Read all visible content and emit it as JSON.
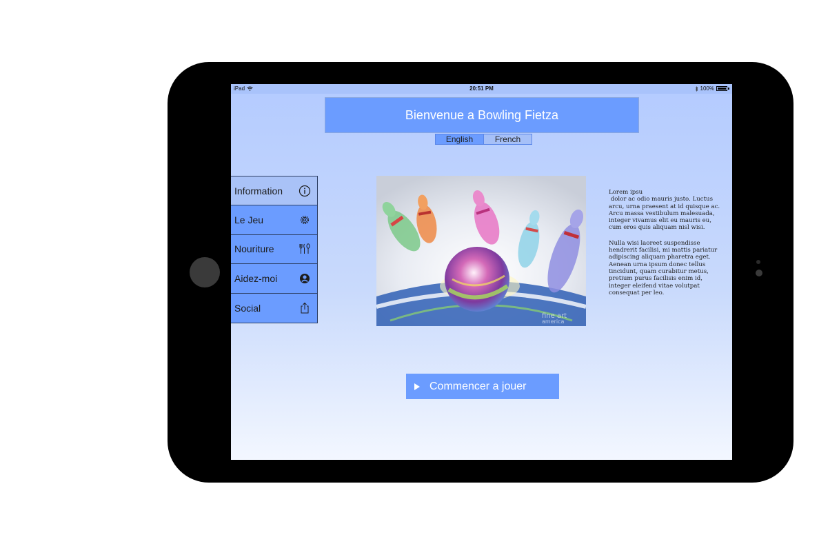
{
  "status_bar": {
    "device": "iPad",
    "wifi_icon": "wifi-icon",
    "time": "20:51 PM",
    "bluetooth_icon": "bluetooth-icon",
    "battery": "100%"
  },
  "header": {
    "title": "Bienvenue a Bowling Fietza"
  },
  "language_toggle": {
    "options": [
      "English",
      "French"
    ],
    "selected": "English"
  },
  "sidebar": {
    "items": [
      {
        "label": "Information",
        "icon": "info-icon"
      },
      {
        "label": "Le Jeu",
        "icon": "gear-icon"
      },
      {
        "label": "Nouriture",
        "icon": "utensils-icon"
      },
      {
        "label": "Aidez-moi",
        "icon": "help-icon"
      },
      {
        "label": "Social",
        "icon": "share-icon"
      }
    ],
    "selected_index": 0
  },
  "hero_image": {
    "description_icon": "bowling-pins-illustration",
    "watermark": "fine art america"
  },
  "body_text": {
    "paragraph_1": "Lorem ipsu\n dolor ac odio mauris justo. Luctus arcu, urna praesent at id quisque ac. Arcu massa vestibulum malesuada, integer vivamus elit eu mauris eu, cum eros quis aliquam nisl wisi.",
    "paragraph_2": "Nulla wisi laoreet suspendisse hendrerit facilisi, mi mattis pariatur adipiscing aliquam pharetra eget. Aenean urna ipsum donec tellus tincidunt, quam curabitur metus, pretium purus facilisis enim id, integer eleifend vitae volutpat consequat per leo."
  },
  "play_button": {
    "label": "Commencer a jouer",
    "icon": "play-icon"
  },
  "colors": {
    "accent": "#6b9cff",
    "selected": "#a9c2f7",
    "device_frame": "#000000"
  }
}
